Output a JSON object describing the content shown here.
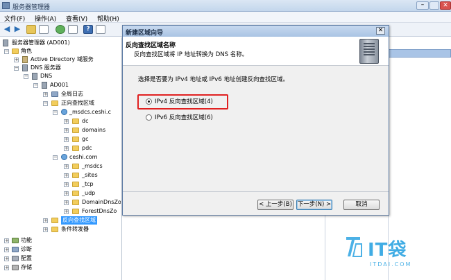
{
  "window": {
    "title": "服务器管理器"
  },
  "menu": [
    "文件(F)",
    "操作(A)",
    "查看(V)",
    "帮助(H)"
  ],
  "tree": {
    "root": "服务器管理器 (AD001)",
    "items": [
      "角色",
      "Active Directory 域服务",
      "DNS 服务器",
      "DNS",
      "AD001",
      "全局日志",
      "正向查找区域",
      "_msdcs.ceshi.c",
      "dc",
      "domains",
      "gc",
      "pdc",
      "ceshi.com",
      "_msdcs",
      "_sites",
      "_tcp",
      "_udp",
      "DomainDnsZo",
      "ForestDnsZo",
      "反向查找区域",
      "条件转发器",
      "功能",
      "诊断",
      "配置",
      "存储"
    ]
  },
  "dialog": {
    "title": "新建区域向导",
    "heading": "反向查找区域名称",
    "subheading": "反向查找区域将 IP 地址转换为 DNS 名称。",
    "prompt": "选择是否要为 IPv4 地址或 IPv6 地址创建反向查找区域。",
    "options": [
      {
        "label": "IPv4 反向查找区域(4)",
        "selected": true
      },
      {
        "label": "IPv6 反向查找区域(6)",
        "selected": false
      }
    ],
    "buttons": {
      "back": "< 上一步(B)",
      "next": "下一步(N) >",
      "cancel": "取消"
    }
  },
  "watermark": {
    "brand": "IT袋",
    "url": "ITDAI.COM"
  },
  "colors": {
    "selection": "#3399ff",
    "highlight_box": "#e02020",
    "watermark": "#1f9ee0"
  }
}
